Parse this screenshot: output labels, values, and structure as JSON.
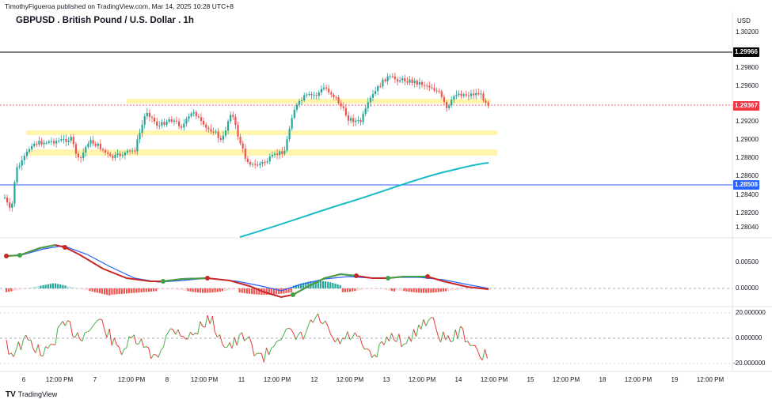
{
  "header": {
    "publisher_line": "TimothyFigueroa published on TradingView.com, Mar 14, 2025 10:28 UTC+8",
    "symbol_title": "GBPUSD . British Pound / U.S. Dollar . 1h"
  },
  "price_axis": {
    "currency": "USD",
    "ticks": [
      "1.30200",
      "1.29800",
      "1.29600",
      "1.29200",
      "1.29000",
      "1.28800",
      "1.28600",
      "1.28400",
      "1.28200",
      "1.28040"
    ],
    "tags": [
      {
        "label": "1.29966",
        "color": "#000000"
      },
      {
        "label": "1.29367",
        "color": "#f23645"
      },
      {
        "label": "1.28508",
        "color": "#2962ff"
      }
    ]
  },
  "osc1_axis": {
    "ticks": [
      "0.00500",
      "0.00000"
    ]
  },
  "osc2_axis": {
    "ticks": [
      "20.000000",
      "0.000000",
      "-20.000000"
    ]
  },
  "time_axis": {
    "labels": [
      "6",
      "12:00 PM",
      "7",
      "12:00 PM",
      "8",
      "12:00 PM",
      "11",
      "12:00 PM",
      "12",
      "12:00 PM",
      "13",
      "12:00 PM",
      "14",
      "12:00 PM",
      "15",
      "12:00 PM",
      "18",
      "12:00 PM",
      "19",
      "12:00 PM"
    ]
  },
  "footer": {
    "brand_logo": "TV",
    "brand_name": "TradingView"
  },
  "colors": {
    "up": "#26a69a",
    "down": "#ef5350",
    "zone": "#fff3a0",
    "ema": "#18bcc8",
    "blue_line": "#2962ff",
    "red_line": "#c62828",
    "green_line": "#43a047"
  }
}
